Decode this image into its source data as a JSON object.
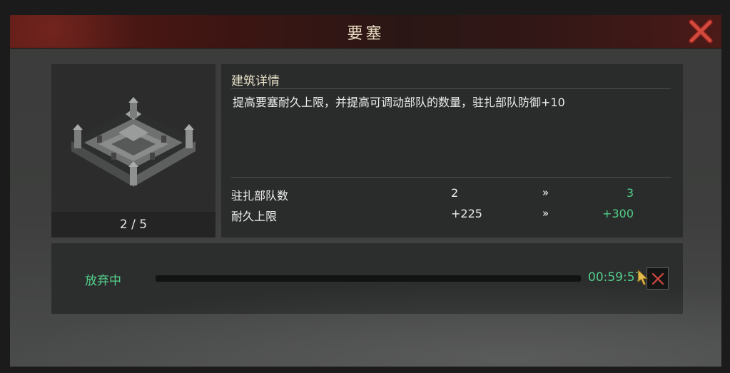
{
  "dialog": {
    "title": "要塞",
    "close_icon": "close-x-icon"
  },
  "building": {
    "image_icon": "fortress-icon",
    "level_text": "2 / 5"
  },
  "details": {
    "heading": "建筑详情",
    "description": "提高要塞耐久上限，并提高可调动部队的数量，驻扎部队防御+10",
    "stats": [
      {
        "label": "驻扎部队数",
        "current": "2",
        "arrow": "»",
        "next": "3"
      },
      {
        "label": "耐久上限",
        "current": "+225",
        "arrow": "»",
        "next": "+300"
      }
    ]
  },
  "progress": {
    "status": "放弃中",
    "timer": "00:59:57",
    "cancel_icon": "cancel-x-icon"
  },
  "colors": {
    "accent_green": "#52d18a",
    "title_bar": "#3d1512",
    "close_red": "#c9463d"
  }
}
